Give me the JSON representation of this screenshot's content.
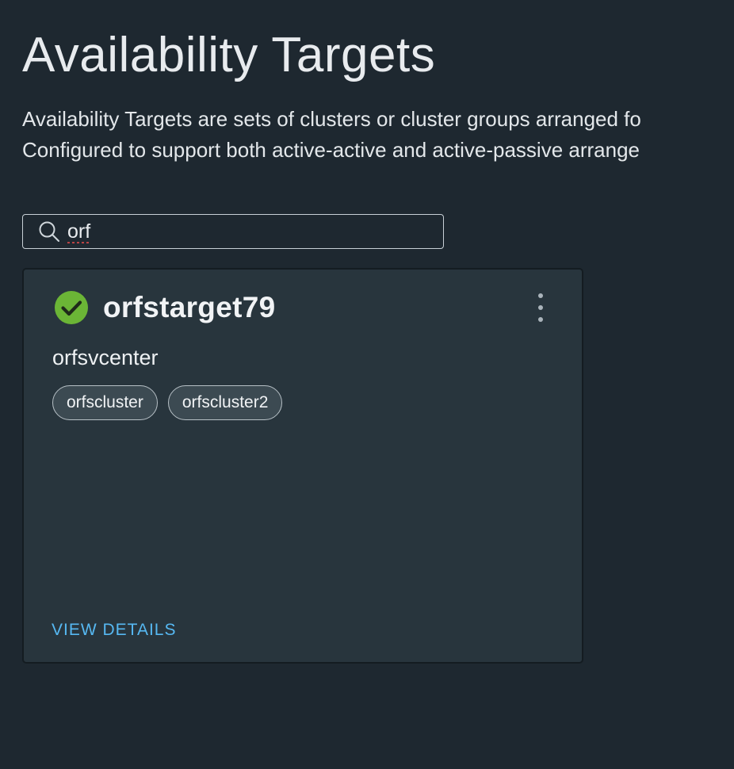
{
  "page": {
    "title": "Availability Targets",
    "description_lines": [
      "Availability Targets are sets of clusters or cluster groups arranged fo",
      "Configured to support both active-active and active-passive arrange"
    ]
  },
  "search": {
    "value": "orf",
    "icon": "search-icon"
  },
  "cards": [
    {
      "status_icon": "check-circle-icon",
      "status_color": "#6bb536",
      "name": "orfstarget79",
      "vcenter": "orfsvcenter",
      "clusters": [
        "orfscluster",
        "orfscluster2"
      ],
      "action_label": "VIEW DETAILS",
      "menu_icon": "kebab-menu-icon"
    }
  ],
  "colors": {
    "background": "#1e2830",
    "card_background": "#28353d",
    "link": "#56b8f2",
    "chip_background": "#3c4a52"
  }
}
